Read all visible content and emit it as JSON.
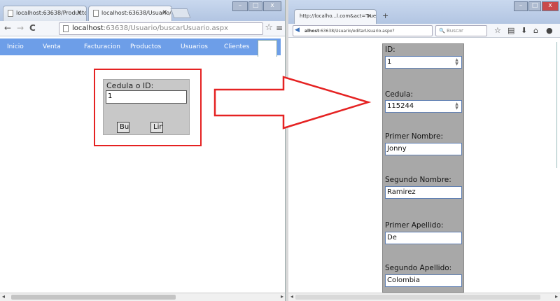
{
  "left": {
    "tabs": [
      {
        "label": "localhost:63638/Producto"
      },
      {
        "label": "localhost:63638/Usuario/"
      }
    ],
    "address": {
      "host": "localhost",
      "rest": ":63638/Usuario/buscarUsuario.aspx"
    },
    "nav": [
      "Inicio",
      "Venta",
      "Facturacion",
      "Productos",
      "Usuarios",
      "Clientes"
    ],
    "search": {
      "label": "Cedula o ID:",
      "value": "1",
      "btn1": "Bu",
      "btn2": "Lin"
    }
  },
  "right": {
    "tab": {
      "label": "http://localho...l.com&act=True"
    },
    "address": {
      "host": "alhost",
      "rest": ":63638/Usuario/editarUsuario.aspx?"
    },
    "search_placeholder": "Buscar",
    "fields": [
      {
        "label": "ID:",
        "value": "1"
      },
      {
        "label": "Cedula:",
        "value": "115244"
      },
      {
        "label": "Primer Nombre:",
        "value": "Jonny"
      },
      {
        "label": "Segundo Nombre:",
        "value": "Ramirez"
      },
      {
        "label": "Primer Apellido:",
        "value": "De"
      },
      {
        "label": "Segundo Apellido:",
        "value": "Colombia"
      }
    ]
  },
  "colors": {
    "nav_bar": "#6d9ee8",
    "highlight": "#e52222",
    "panel": "#c8c8c8",
    "form_panel": "#a8a8a8"
  }
}
